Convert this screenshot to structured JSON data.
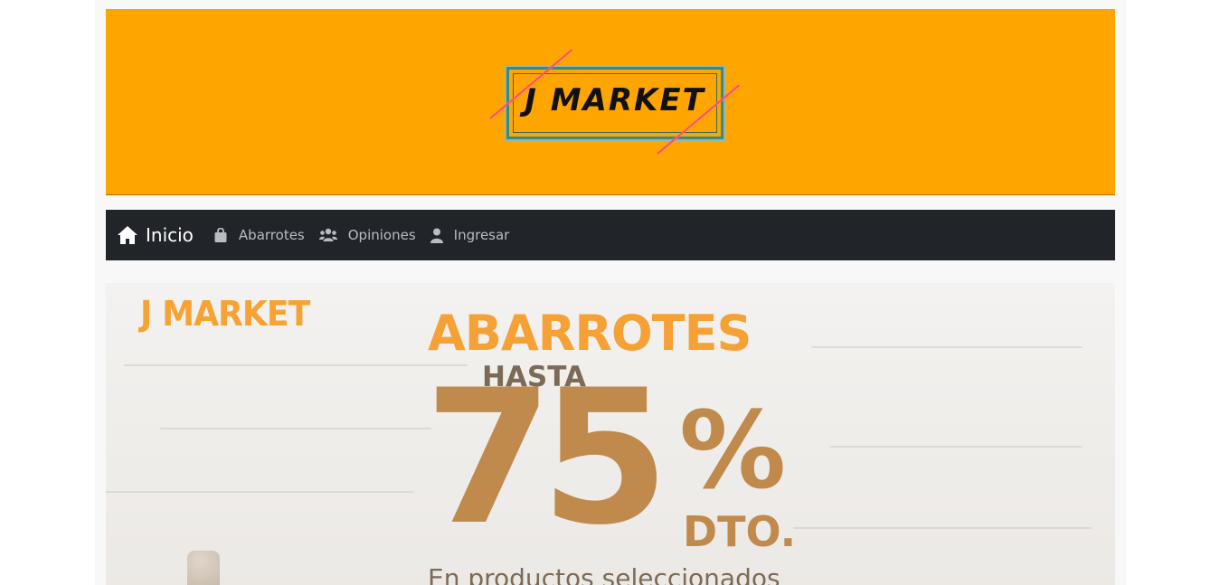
{
  "header": {
    "logo_text": "J MARKET"
  },
  "nav": {
    "brand_label": "Inicio",
    "items": [
      {
        "label": "Abarrotes",
        "icon": "shopping-bag-icon"
      },
      {
        "label": "Opiniones",
        "icon": "users-icon"
      },
      {
        "label": "Ingresar",
        "icon": "user-icon"
      }
    ]
  },
  "promo": {
    "brand": "J MARKET",
    "headline": "ABARROTES",
    "upto": "HASTA",
    "discount_value": "75",
    "discount_sign": "%",
    "discount_suffix": "DTO.",
    "subtitle": "En productos seleccionados"
  },
  "colors": {
    "header_bg": "#ffa500",
    "navbar_bg": "#212529",
    "promo_orange": "#f5a136",
    "promo_brown": "#c08a4c"
  }
}
